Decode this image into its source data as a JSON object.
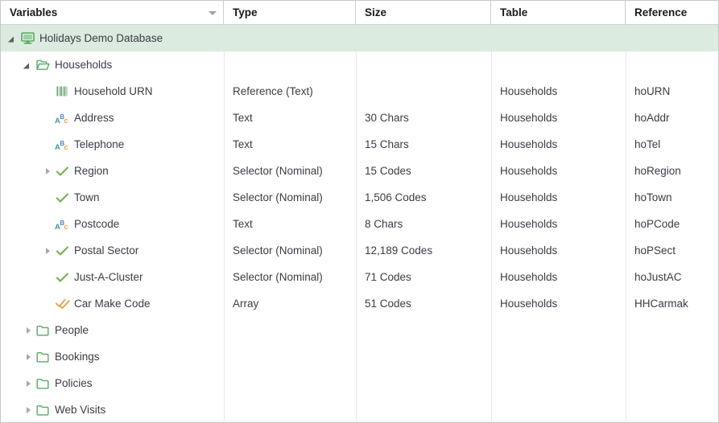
{
  "window": {
    "title": "Variables Tree Grid"
  },
  "colors": {
    "selection_background": "#dcebdf",
    "accent_green": "#5aa963",
    "icon_orange": "#e0a64a",
    "icon_blue": "#4f86c6",
    "icon_teal": "#3c9c8a",
    "grid_line": "#e8e8e8",
    "header_text": "#1a1a1a",
    "row_text": "#3b3b46"
  },
  "header": {
    "columns": [
      {
        "label": "Variables",
        "sort_indicator": "chevron-down-icon"
      },
      {
        "label": "Type"
      },
      {
        "label": "Size"
      },
      {
        "label": "Table"
      },
      {
        "label": "Reference"
      }
    ]
  },
  "rows": [
    {
      "name": "Holidays Demo Database",
      "type": "",
      "size": "",
      "table": "",
      "reference": "",
      "indent": 0,
      "twisty": "expanded",
      "icon": "database-monitor-icon",
      "selected": true
    },
    {
      "name": "Households",
      "type": "",
      "size": "",
      "table": "",
      "reference": "",
      "indent": 1,
      "twisty": "expanded",
      "icon": "folder-open-icon",
      "selected": false
    },
    {
      "name": "Household URN",
      "type": "Reference (Text)",
      "size": "",
      "table": "Households",
      "reference": "hoURN",
      "indent": 2,
      "twisty": "none",
      "icon": "barcode-reference-icon",
      "selected": false
    },
    {
      "name": "Address",
      "type": "Text",
      "size": "30 Chars",
      "table": "Households",
      "reference": "hoAddr",
      "indent": 2,
      "twisty": "none",
      "icon": "abc-text-icon",
      "selected": false
    },
    {
      "name": "Telephone",
      "type": "Text",
      "size": "15 Chars",
      "table": "Households",
      "reference": "hoTel",
      "indent": 2,
      "twisty": "none",
      "icon": "abc-text-icon",
      "selected": false
    },
    {
      "name": "Region",
      "type": "Selector (Nominal)",
      "size": "15 Codes",
      "table": "Households",
      "reference": "hoRegion",
      "indent": 2,
      "twisty": "collapsed",
      "icon": "check-selector-icon",
      "selected": false
    },
    {
      "name": "Town",
      "type": "Selector (Nominal)",
      "size": "1,506 Codes",
      "table": "Households",
      "reference": "hoTown",
      "indent": 2,
      "twisty": "none",
      "icon": "check-selector-icon",
      "selected": false
    },
    {
      "name": "Postcode",
      "type": "Text",
      "size": "8 Chars",
      "table": "Households",
      "reference": "hoPCode",
      "indent": 2,
      "twisty": "none",
      "icon": "abc-text-icon",
      "selected": false
    },
    {
      "name": "Postal Sector",
      "type": "Selector (Nominal)",
      "size": "12,189 Codes",
      "table": "Households",
      "reference": "hoPSect",
      "indent": 2,
      "twisty": "collapsed",
      "icon": "check-selector-icon",
      "selected": false
    },
    {
      "name": "Just-A-Cluster",
      "type": "Selector (Nominal)",
      "size": "71 Codes",
      "table": "Households",
      "reference": "hoJustAC",
      "indent": 2,
      "twisty": "none",
      "icon": "check-selector-icon",
      "selected": false
    },
    {
      "name": "Car Make Code",
      "type": "Array",
      "size": "51 Codes",
      "table": "Households",
      "reference": "HHCarmak",
      "indent": 2,
      "twisty": "none",
      "icon": "double-check-array-icon",
      "selected": false
    },
    {
      "name": "People",
      "type": "",
      "size": "",
      "table": "",
      "reference": "",
      "indent": 1,
      "twisty": "collapsed",
      "icon": "folder-closed-icon",
      "selected": false
    },
    {
      "name": "Bookings",
      "type": "",
      "size": "",
      "table": "",
      "reference": "",
      "indent": 1,
      "twisty": "collapsed",
      "icon": "folder-closed-icon",
      "selected": false
    },
    {
      "name": "Policies",
      "type": "",
      "size": "",
      "table": "",
      "reference": "",
      "indent": 1,
      "twisty": "collapsed",
      "icon": "folder-closed-icon",
      "selected": false
    },
    {
      "name": "Web Visits",
      "type": "",
      "size": "",
      "table": "",
      "reference": "",
      "indent": 1,
      "twisty": "collapsed",
      "icon": "folder-closed-icon",
      "selected": false
    }
  ]
}
